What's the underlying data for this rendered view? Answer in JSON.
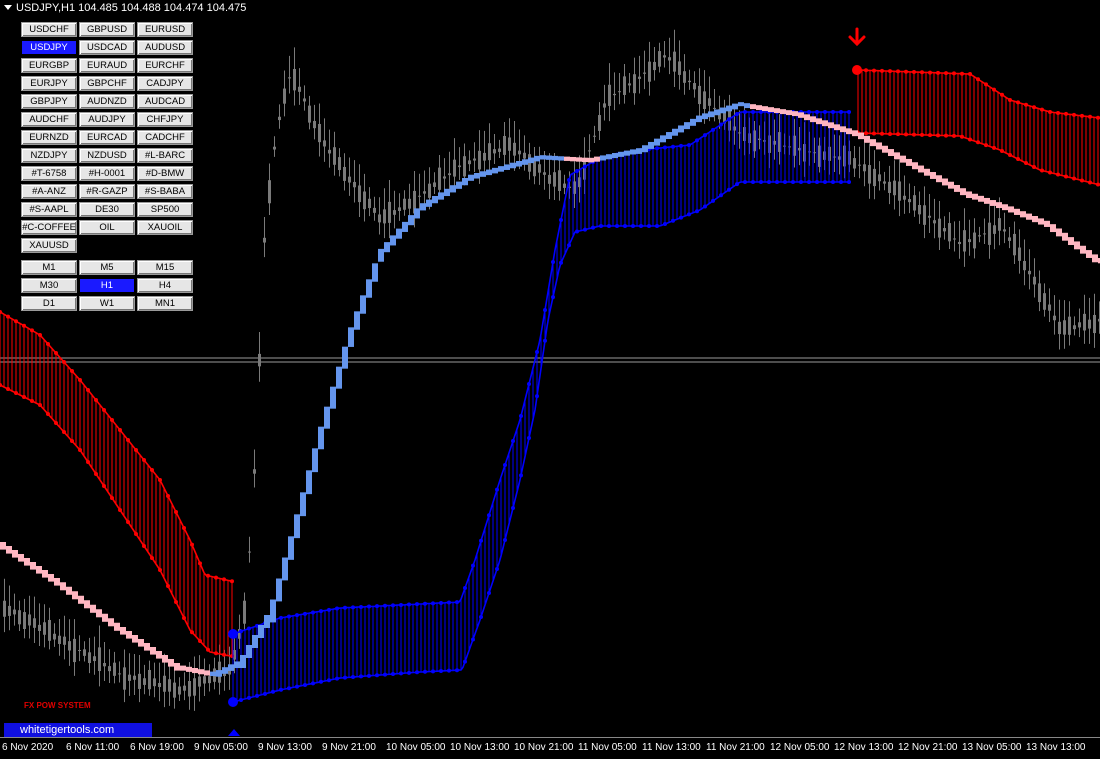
{
  "chart": {
    "title": "USDJPY,H1  104.485 104.488 104.474 104.475"
  },
  "symbols": [
    "USDCHF",
    "GBPUSD",
    "EURUSD",
    "USDJPY",
    "USDCAD",
    "AUDUSD",
    "EURGBP",
    "EURAUD",
    "EURCHF",
    "EURJPY",
    "GBPCHF",
    "CADJPY",
    "GBPJPY",
    "AUDNZD",
    "AUDCAD",
    "AUDCHF",
    "AUDJPY",
    "CHFJPY",
    "EURNZD",
    "EURCAD",
    "CADCHF",
    "NZDJPY",
    "NZDUSD",
    "#L-BARC",
    "#T-6758",
    "#H-0001",
    "#D-BMW",
    "#A-ANZ",
    "#R-GAZP",
    "#S-BABA",
    "#S-AAPL",
    "DE30",
    "SP500",
    "#C-COFFEE",
    "OIL",
    "XAUOIL",
    "XAUUSD"
  ],
  "active_symbol": "USDJPY",
  "timeframes": [
    "M1",
    "M5",
    "M15",
    "M30",
    "H1",
    "H4",
    "D1",
    "W1",
    "MN1"
  ],
  "active_timeframe": "H1",
  "x_labels": [
    "6 Nov 2020",
    "6 Nov 11:00",
    "6 Nov 19:00",
    "9 Nov 05:00",
    "9 Nov 13:00",
    "9 Nov 21:00",
    "10 Nov 05:00",
    "10 Nov 13:00",
    "10 Nov 21:00",
    "11 Nov 05:00",
    "11 Nov 13:00",
    "11 Nov 21:00",
    "12 Nov 05:00",
    "12 Nov 13:00",
    "12 Nov 21:00",
    "13 Nov 05:00",
    "13 Nov 13:00"
  ],
  "brand": "whitetigertools.com",
  "indicator_label": "FX POW SYSTEM",
  "colors": {
    "background": "#000000",
    "candle": "#7a7a7a",
    "bear_band": "#ff0000",
    "bull_band": "#0000ff",
    "bull_ribbon": "#6495ed",
    "bear_ribbon": "#ffb6c1",
    "active_button": "#1a1aff"
  }
}
